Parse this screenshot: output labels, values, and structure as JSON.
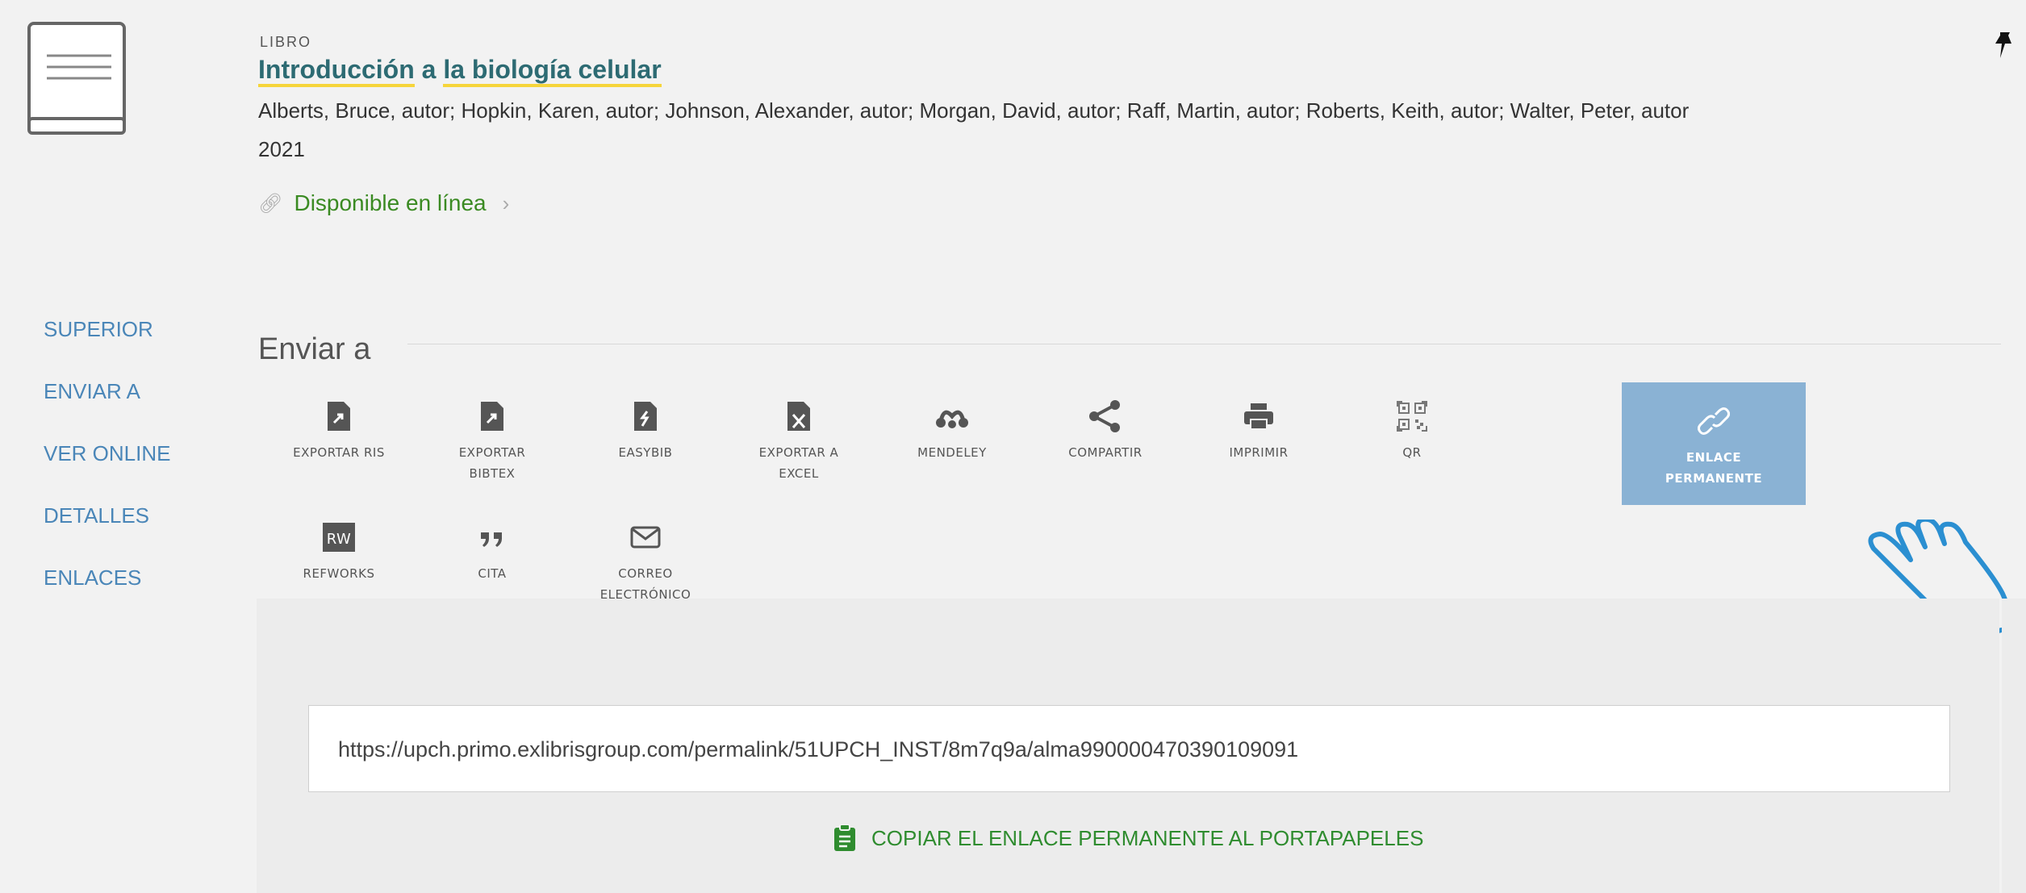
{
  "record": {
    "doc_type": "LIBRO",
    "title_parts": [
      "Introducción",
      "a",
      "la biología celular"
    ],
    "authors": "Alberts, Bruce, autor; Hopkin, Karen, autor; Johnson, Alexander, autor; Morgan, David, autor; Raff, Martin, autor; Roberts, Keith, autor; Walter, Peter, autor",
    "year": "2021",
    "availability": "Disponible en línea"
  },
  "nav": {
    "items": [
      "SUPERIOR",
      "ENVIAR A",
      "VER ONLINE",
      "DETALLES",
      "ENLACES"
    ]
  },
  "send_to": {
    "title": "Enviar a",
    "actions": [
      {
        "label": "EXPORTAR RIS",
        "icon": "file-export-icon"
      },
      {
        "label": "EXPORTAR\nBIBTEX",
        "icon": "file-export-icon"
      },
      {
        "label": "EASYBIB",
        "icon": "easybib-icon"
      },
      {
        "label": "EXPORTAR A\nEXCEL",
        "icon": "excel-file-icon"
      },
      {
        "label": "MENDELEY",
        "icon": "mendeley-icon"
      },
      {
        "label": "COMPARTIR",
        "icon": "share-icon"
      },
      {
        "label": "IMPRIMIR",
        "icon": "print-icon"
      },
      {
        "label": "QR",
        "icon": "qr-code-icon"
      },
      {
        "label": "ENLACE\nPERMANENTE",
        "icon": "link-icon",
        "active": true
      },
      {
        "label": "REFWORKS",
        "icon": "refworks-icon"
      },
      {
        "label": "CITA",
        "icon": "quote-icon"
      },
      {
        "label": "CORREO\nELECTRÓNICO",
        "icon": "email-icon"
      }
    ]
  },
  "permalink": {
    "url": "https://upch.primo.exlibrisgroup.com/permalink/51UPCH_INST/8m7q9a/alma990000470390109091",
    "copy_label": "COPIAR EL ENLACE PERMANENTE AL PORTAPAPELES"
  },
  "colors": {
    "title": "#2d6b73",
    "highlight": "#f6d53b",
    "available": "#3a8a22",
    "nav_link": "#4a86b8",
    "active_tile": "#8ab2d4",
    "copy_green": "#2f8c2f",
    "hand_outline": "#2b8fd1"
  }
}
